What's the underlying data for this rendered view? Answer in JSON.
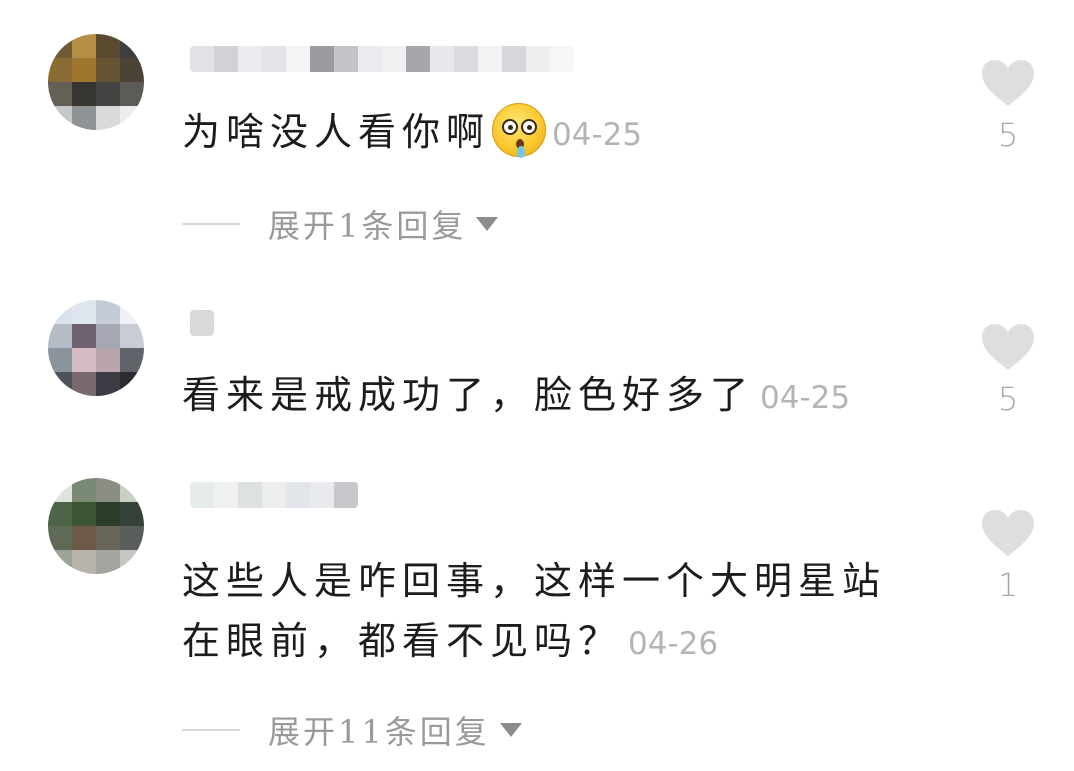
{
  "comments": [
    {
      "text": "为啥没人看你啊",
      "emoji": "shocked-drooling-face-emoji",
      "date": "04-25",
      "likes": "5",
      "replies_label": "展开1条回复"
    },
    {
      "text": "看来是戒成功了，脸色好多了",
      "date": "04-25",
      "likes": "5"
    },
    {
      "text": "这些人是咋回事，这样一个大明星站在眼前，都看不见吗？",
      "date": "04-26",
      "likes": "1",
      "replies_label": "展开11条回复"
    }
  ],
  "icons": {
    "like": "heart-icon",
    "expand": "triangle-down-icon"
  },
  "colors": {
    "text": "#1c1c1c",
    "meta": "#b4b4b4",
    "heart": "#dedede",
    "reply_label": "#9a9a9a",
    "background": "#ffffff"
  }
}
